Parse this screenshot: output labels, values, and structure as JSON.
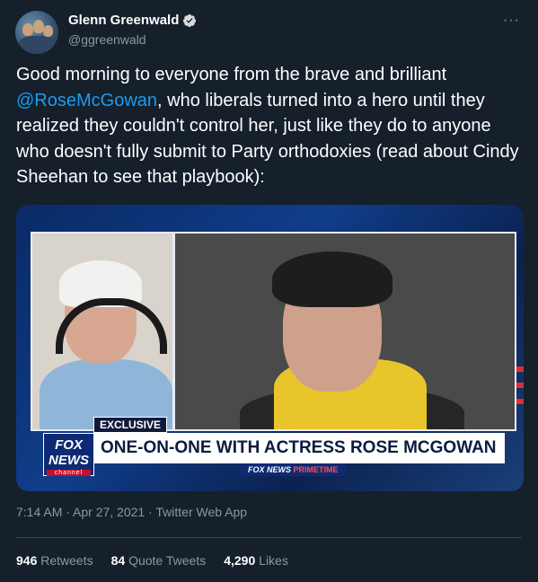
{
  "user": {
    "name": "Glenn Greenwald",
    "handle": "@ggreenwald"
  },
  "tweet": {
    "text_before": "Good morning to everyone from the brave and brilliant ",
    "mention": "@RoseMcGowan",
    "text_after": ", who liberals turned into a hero until they realized they couldn't control her, just like they do to anyone who doesn't fully submit to Party orthodoxies (read about Cindy Sheehan to see that playbook):",
    "timestamp": "7:14 AM · Apr 27, 2021 · Twitter Web App"
  },
  "media": {
    "badge": "EXCLUSIVE",
    "headline": "ONE-ON-ONE WITH ACTRESS ROSE MCGOWAN",
    "network_logo_top": "FOX",
    "network_logo_bottom": "NEWS",
    "network_logo_channel": "channel",
    "strap_network": "FOX NEWS",
    "strap_show": "PRIMETIME"
  },
  "stats": {
    "retweets_count": "946",
    "retweets_label": "Retweets",
    "quotes_count": "84",
    "quotes_label": "Quote Tweets",
    "likes_count": "4,290",
    "likes_label": "Likes"
  },
  "colors": {
    "background": "#15202b",
    "mention": "#1d9bf0",
    "verified": "#1d9bf0"
  },
  "icons": {
    "verified": "verified-badge-icon",
    "more": "more-options-icon"
  }
}
